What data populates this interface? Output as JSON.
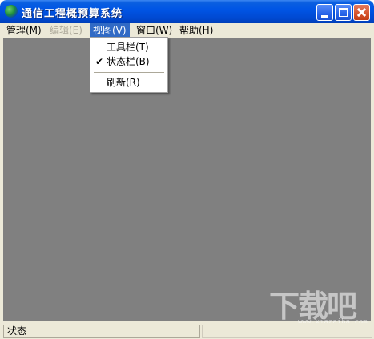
{
  "window": {
    "title": "通信工程概预算系统"
  },
  "menubar": {
    "items": [
      {
        "label": "管理(M)",
        "enabled": true
      },
      {
        "label": "编辑(E)",
        "enabled": false
      },
      {
        "label": "视图(V)",
        "enabled": true,
        "active": true
      },
      {
        "label": "窗口(W)",
        "enabled": true
      },
      {
        "label": "帮助(H)",
        "enabled": true
      }
    ]
  },
  "view_menu": {
    "items": [
      {
        "label": "工具栏(T)",
        "checked": false
      },
      {
        "label": "状态栏(B)",
        "checked": true
      },
      {
        "label": "刷新(R)",
        "checked": false
      }
    ],
    "check_glyph": "✔"
  },
  "statusbar": {
    "text": "状态"
  },
  "watermark": {
    "logo": "下载吧",
    "url": "www.xiazaiba.com"
  },
  "colors": {
    "titlebar": "#0055e5",
    "client": "#808080",
    "menu_highlight": "#316ac5",
    "chrome": "#ece9d8"
  }
}
